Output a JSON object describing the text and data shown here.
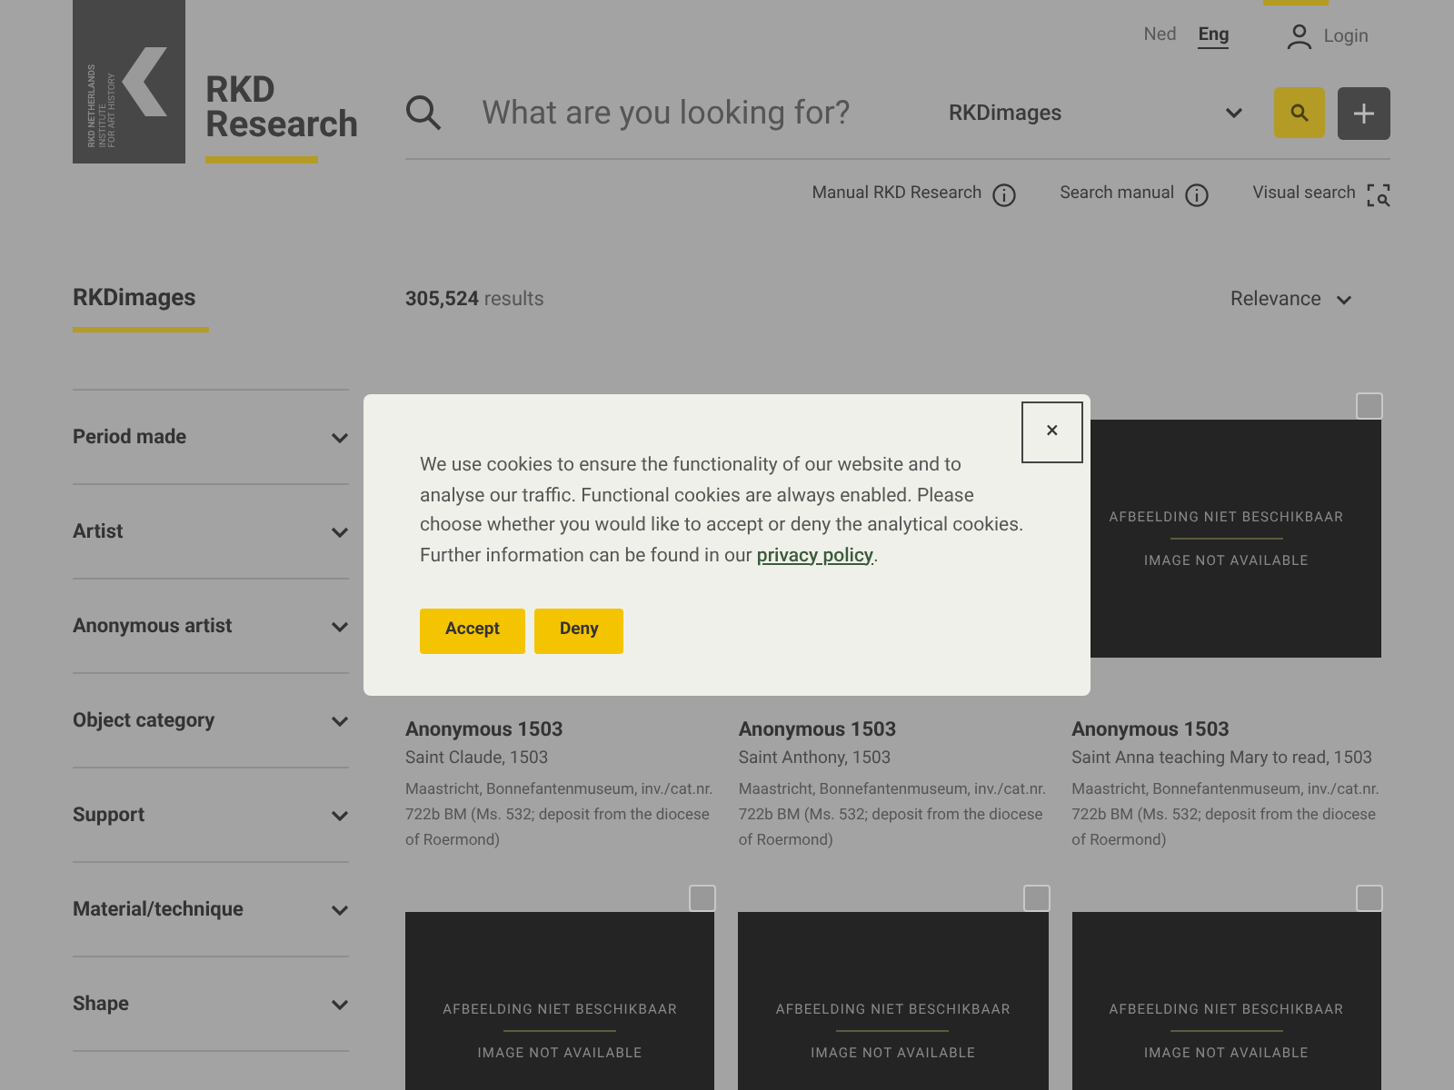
{
  "header": {
    "logo": {
      "tagline": [
        "RKD NETHERLANDS",
        "INSTITUTE",
        "FOR ART HISTORY"
      ]
    },
    "site_title": [
      "RKD",
      "Research"
    ],
    "languages": [
      {
        "label": "Ned",
        "selected": false
      },
      {
        "label": "Eng",
        "selected": true
      }
    ],
    "login": "Login",
    "search": {
      "placeholder": "What are you looking for?",
      "database": "RKDimages"
    },
    "links": [
      {
        "label": "Manual RKD Research",
        "kind": "info"
      },
      {
        "label": "Search manual",
        "kind": "info"
      },
      {
        "label": "Visual search",
        "kind": "visual"
      }
    ]
  },
  "sidebar": {
    "title": "RKDimages",
    "filters": [
      {
        "label": "Period made",
        "expanded": false
      },
      {
        "label": "Artist",
        "expanded": false
      },
      {
        "label": "Anonymous artist",
        "expanded": false
      },
      {
        "label": "Object category",
        "expanded": false
      },
      {
        "label": "Support",
        "expanded": false
      },
      {
        "label": "Material/technique",
        "expanded": false
      },
      {
        "label": "Shape",
        "expanded": false
      }
    ]
  },
  "results": {
    "count": "305,524",
    "count_label": "results",
    "sort": "Relevance"
  },
  "cards": [
    {
      "title": "Anonymous 1503",
      "subtitle": "Saint Claude, 1503",
      "description": "Maastricht, Bonnefantenmuseum, inv./cat.nr. 722b BM (Ms. 532; deposit from the diocese of Roermond)"
    },
    {
      "title": "Anonymous 1503",
      "subtitle": "Saint Anthony, 1503",
      "description": "Maastricht, Bonnefantenmuseum, inv./cat.nr. 722b BM (Ms. 532; deposit from the diocese of Roermond)"
    },
    {
      "image": [
        "AFBEELDING NIET BESCHIKBAAR",
        "IMAGE NOT AVAILABLE"
      ],
      "checkbox": {
        "checked": false
      },
      "title": "Anonymous 1503",
      "subtitle": "Saint Anna teaching Mary to read, 1503",
      "description": "Maastricht, Bonnefantenmuseum, inv./cat.nr. 722b BM (Ms. 532; deposit from the diocese of Roermond)"
    },
    {
      "image": [
        "AFBEELDING NIET BESCHIKBAAR",
        "IMAGE NOT AVAILABLE"
      ],
      "checkbox": {
        "checked": false
      }
    },
    {
      "image": [
        "AFBEELDING NIET BESCHIKBAAR",
        "IMAGE NOT AVAILABLE"
      ],
      "checkbox": {
        "checked": false
      }
    },
    {
      "image": [
        "AFBEELDING NIET BESCHIKBAAR",
        "IMAGE NOT AVAILABLE"
      ],
      "checkbox": {
        "checked": false
      }
    }
  ],
  "cookie_dialog": {
    "text": "We use cookies to ensure the functionality of our website and to analyse our traffic. Functional cookies are always enabled. Please choose whether you would like to accept or deny the analytical cookies. Further information can be found in our ",
    "link": "privacy policy",
    "text_end": ".",
    "close": "×",
    "buttons": [
      "Accept",
      "Deny"
    ]
  }
}
